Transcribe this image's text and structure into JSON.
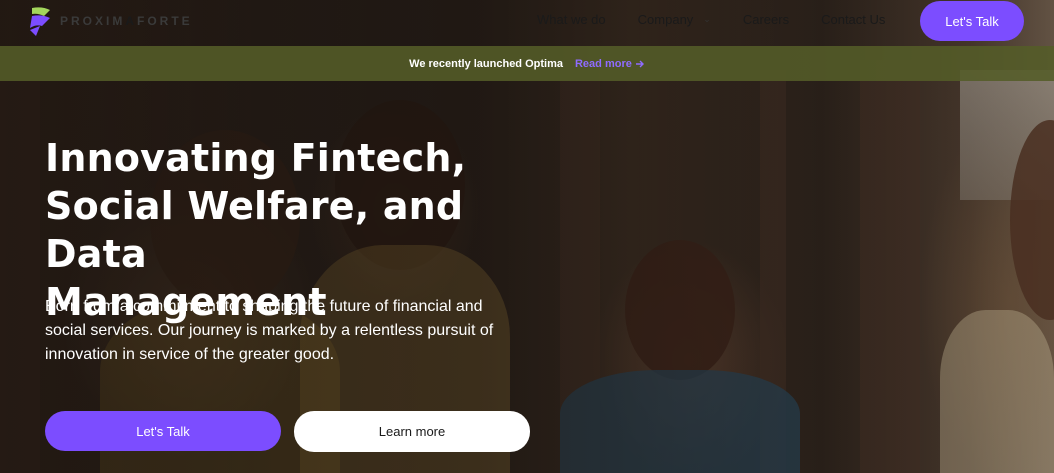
{
  "brand": {
    "name_prefix": "PROXIM",
    "name_highlight": "A",
    "name_suffix": "FORTE",
    "logo_colors": [
      "#7c4dff",
      "#a3d65c"
    ]
  },
  "nav": {
    "items": [
      {
        "label": "What we do"
      },
      {
        "label": "Company",
        "has_dropdown": true
      },
      {
        "label": "Careers"
      },
      {
        "label": "Contact Us"
      }
    ],
    "cta_label": "Let's Talk"
  },
  "announcement": {
    "text": "We recently launched Optima",
    "link_label": "Read more",
    "link_icon": "arrow-right-icon"
  },
  "hero": {
    "title_lines": [
      "Innovating Fintech,",
      "Social Welfare, and Data",
      "Management"
    ],
    "body": "Born from a commitment to shaping the future of financial and social services. Our journey is marked by a relentless pursuit of innovation in service of the greater good.",
    "primary_button": "Let's Talk",
    "secondary_button": "Learn more"
  },
  "colors": {
    "accent": "#7c4dff",
    "announcement_bg": "#545c28",
    "text_light": "#ffffff"
  }
}
